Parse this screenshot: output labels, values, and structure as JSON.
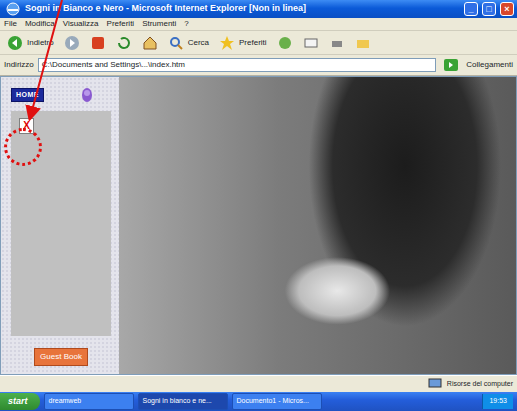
{
  "window": {
    "title": "Sogni in Bianco e Nero - Microsoft Internet Explorer [Non in linea]",
    "controls": [
      "_",
      "□",
      "×"
    ]
  },
  "menu": [
    "File",
    "Modifica",
    "Visualizza",
    "Preferiti",
    "Strumenti",
    "?"
  ],
  "toolbar": [
    "Indietro",
    "Cerca",
    "Preferiti"
  ],
  "address": {
    "label": "Indirizzo",
    "url": "C:\\Documents and Settings\\...\\index.htm",
    "links": "Collegamenti"
  },
  "sidebar": {
    "logo": "HOME",
    "broken_image": "X",
    "button": "Guest Book"
  },
  "status_bar": {
    "zone": "Risorse del computer"
  },
  "taskbar": {
    "start": "start",
    "tasks": [
      {
        "label": "dreamweb",
        "selected": false
      },
      {
        "label": "Sogni in bianco e ne...",
        "selected": true
      },
      {
        "label": "Documento1 - Micros...",
        "selected": false
      }
    ],
    "clock": "19:53"
  }
}
